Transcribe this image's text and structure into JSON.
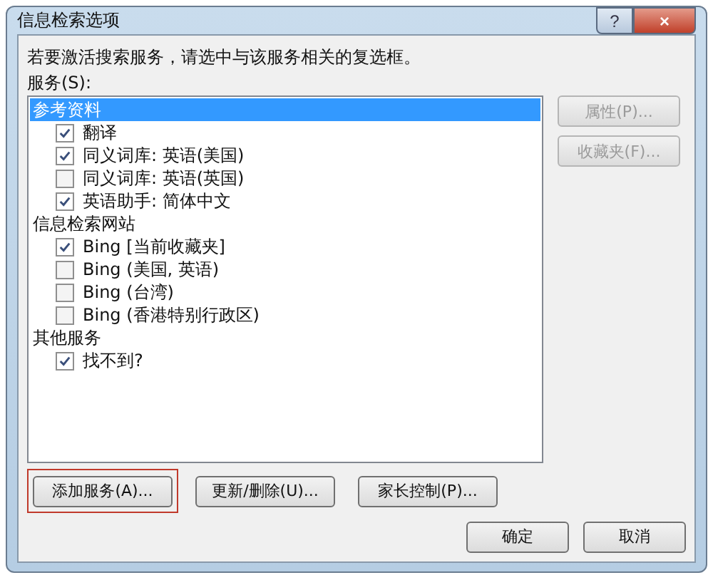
{
  "window": {
    "title": "信息检索选项",
    "help_button": "?",
    "close_button": "×"
  },
  "instruction": "若要激活搜索服务，请选中与该服务相关的复选框。",
  "services_label": "服务(S):",
  "services": [
    {
      "label": "参考资料",
      "selected": true,
      "children": [
        {
          "label": "翻译",
          "checked": true
        },
        {
          "label": "同义词库: 英语(美国)",
          "checked": true
        },
        {
          "label": "同义词库: 英语(英国)",
          "checked": false
        },
        {
          "label": "英语助手: 简体中文",
          "checked": true
        }
      ]
    },
    {
      "label": "信息检索网站",
      "selected": false,
      "children": [
        {
          "label": "Bing [当前收藏夹]",
          "checked": true
        },
        {
          "label": "Bing (美国, 英语)",
          "checked": false
        },
        {
          "label": "Bing (台湾)",
          "checked": false
        },
        {
          "label": "Bing (香港特别行政区)",
          "checked": false
        }
      ]
    },
    {
      "label": "其他服务",
      "selected": false,
      "children": [
        {
          "label": "找不到?",
          "checked": true
        }
      ]
    }
  ],
  "side_buttons": [
    {
      "label": "属性(P)...",
      "disabled": true
    },
    {
      "label": "收藏夹(F)...",
      "disabled": true
    }
  ],
  "bottom_buttons": [
    {
      "label": "添加服务(A)...",
      "highlighted": true
    },
    {
      "label": "更新/删除(U)...",
      "highlighted": false
    },
    {
      "label": "家长控制(P)...",
      "highlighted": false
    }
  ],
  "dialog_buttons": [
    "确定",
    "取消"
  ]
}
